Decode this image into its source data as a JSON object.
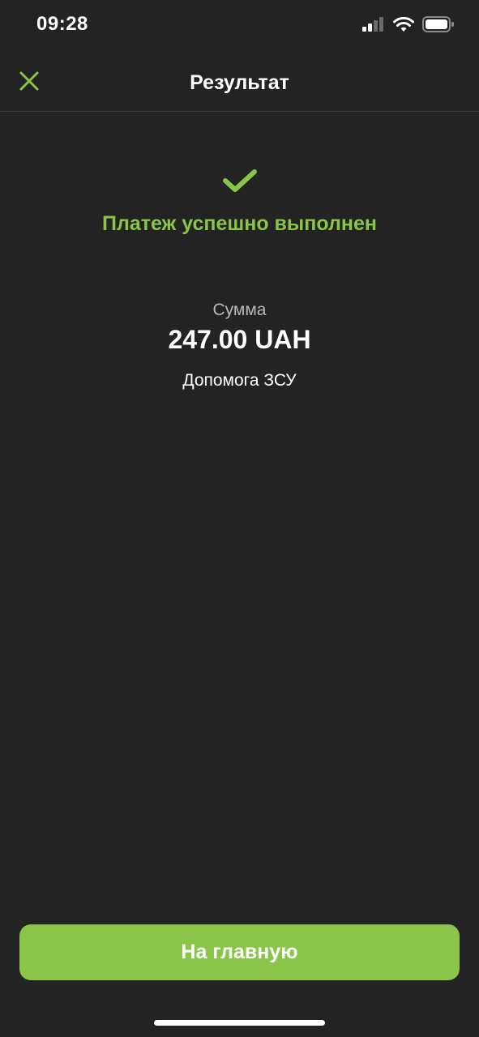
{
  "status_bar": {
    "time": "09:28",
    "icons": [
      "cellular-signal-icon",
      "wifi-icon",
      "battery-icon"
    ]
  },
  "header": {
    "title": "Результат",
    "close_icon": "close-icon"
  },
  "result": {
    "icon": "checkmark-icon",
    "message": "Платеж успешно выполнен",
    "amount_label": "Сумма",
    "amount_value": "247.00 UAH",
    "recipient": "Допомога ЗСУ"
  },
  "footer": {
    "home_button_label": "На главную"
  },
  "colors": {
    "background": "#232323",
    "accent": "#8ac54a",
    "text_primary": "#ffffff",
    "text_secondary": "#b8b8b8",
    "divider": "#3a3a3a"
  }
}
